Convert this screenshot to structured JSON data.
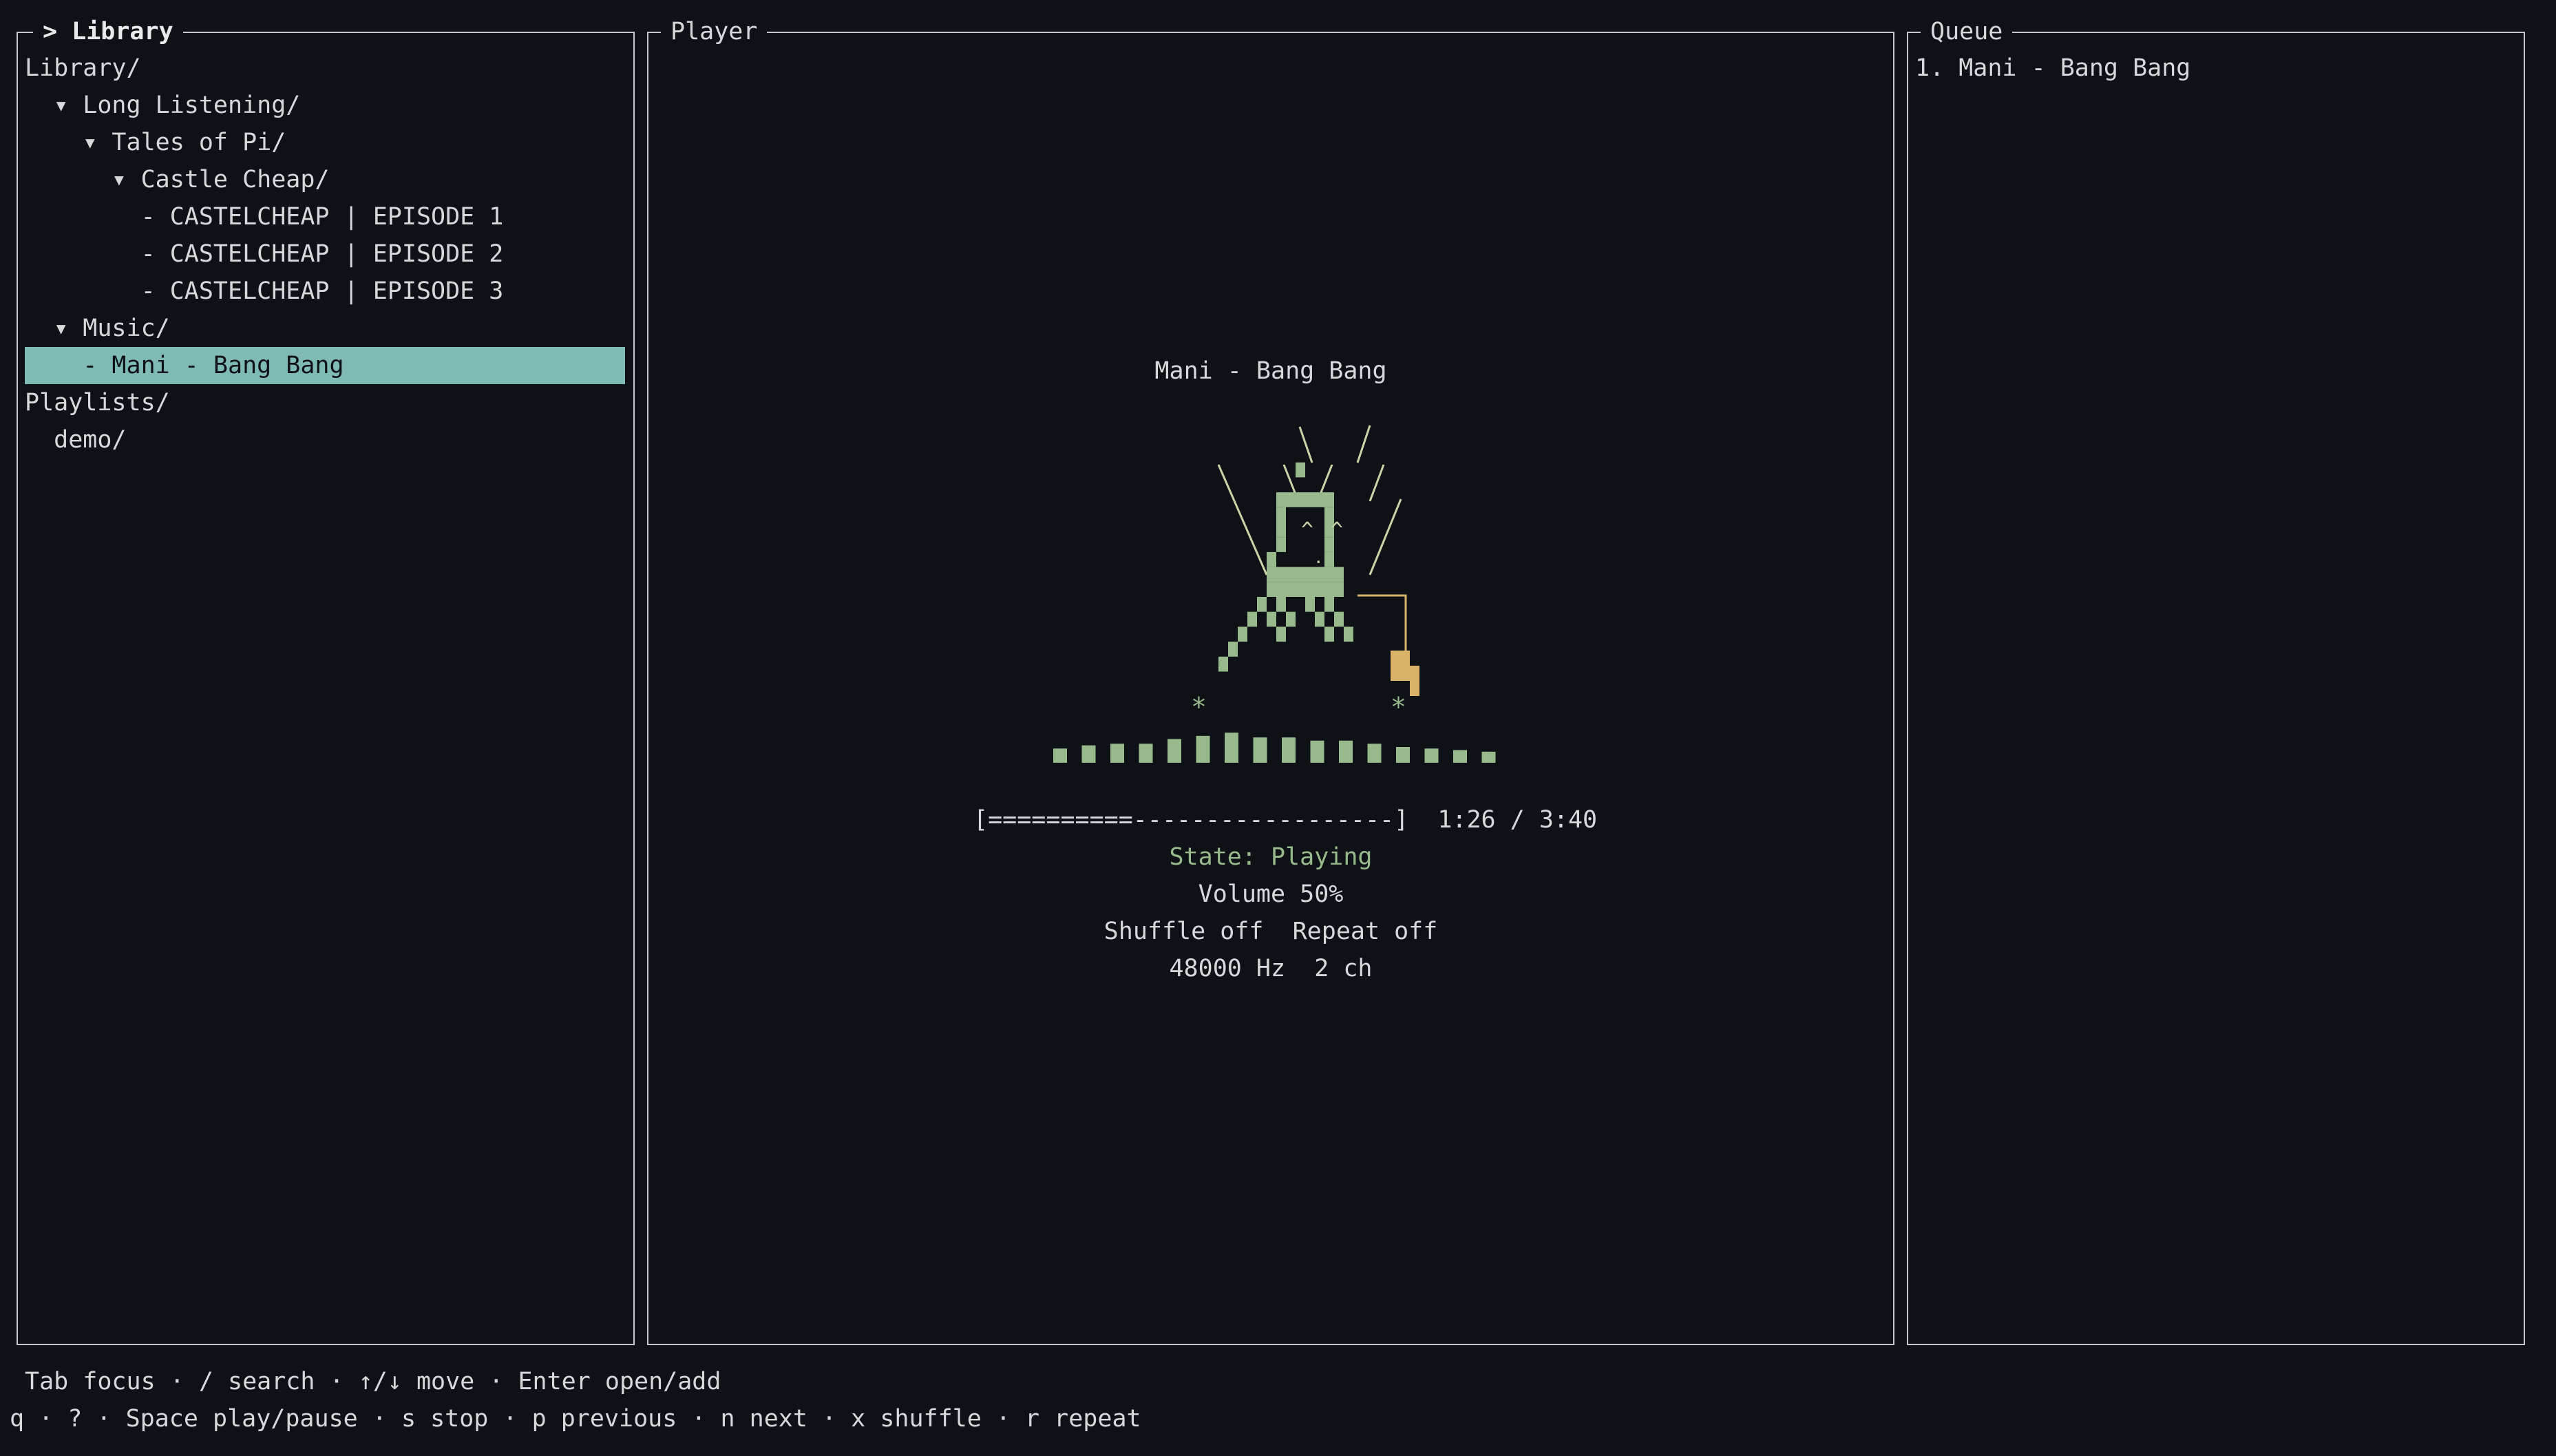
{
  "library": {
    "title": "> Library",
    "items": [
      "Library/",
      "  ▾ Long Listening/",
      "    ▾ Tales of Pi/",
      "      ▾ Castle Cheap/",
      "        - CASTELCHEAP | EPISODE 1",
      "        - CASTELCHEAP | EPISODE 2",
      "        - CASTELCHEAP | EPISODE 3",
      "  ▾ Music/",
      "    - Mani - Bang Bang",
      "Playlists/",
      "  demo/"
    ],
    "selected_index": 8
  },
  "player": {
    "title": "Player",
    "track": "Mani - Bang Bang",
    "progress_bar": "[==========------------------]",
    "progress_fraction": 0.36,
    "time": "1:26 / 3:40",
    "state": "State: Playing",
    "volume": "Volume 50%",
    "modes": "Shuffle off  Repeat off",
    "format": "48000 Hz  2 ch",
    "art_color": "#98b98c",
    "accent_color": "#d9b36a",
    "spectrum": [
      0.45,
      0.55,
      0.6,
      0.6,
      0.75,
      0.85,
      0.95,
      0.8,
      0.8,
      0.7,
      0.7,
      0.6,
      0.5,
      0.45,
      0.4,
      0.35
    ]
  },
  "queue": {
    "title": "Queue",
    "items": [
      "1. Mani - Bang Bang"
    ]
  },
  "footer": {
    "line1": "Tab focus · / search · ↑/↓ move · Enter open/add",
    "line2": "q · ? · Space play/pause · s stop · p previous · n next · x shuffle · r repeat"
  },
  "colors": {
    "background": "#0e1217",
    "border": "#c4c7ca",
    "selection": "#7fbab4",
    "state_text": "#98b98c"
  }
}
